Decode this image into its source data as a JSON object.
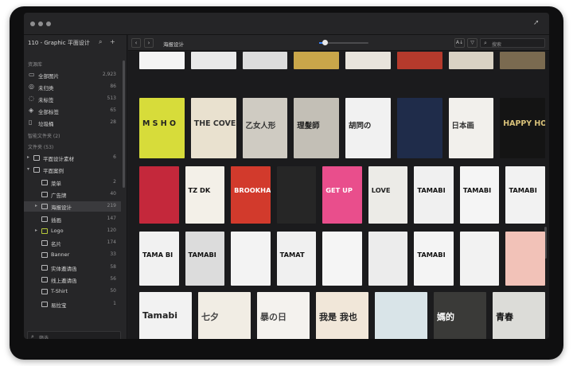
{
  "window": {
    "traffic_lights": 3
  },
  "sidebar": {
    "library_title": "110 - Graphic 平面设计",
    "sections": {
      "resources": "资源库",
      "smart": "智能文件夹 (2)",
      "folders": "文件夹 (53)"
    },
    "library_items": [
      {
        "label": "全部图片",
        "count": "2,923",
        "icon": "images-icon"
      },
      {
        "label": "未归类",
        "count": "86",
        "icon": "uncategorized-icon"
      },
      {
        "label": "未标签",
        "count": "513",
        "icon": "untagged-icon"
      },
      {
        "label": "全部标签",
        "count": "65",
        "icon": "tags-icon"
      },
      {
        "label": "垃圾桶",
        "count": "28",
        "icon": "trash-icon"
      }
    ],
    "folders": [
      {
        "label": "平面设计素材",
        "count": "6",
        "indent": 0,
        "arrow": "▸"
      },
      {
        "label": "平面案例",
        "count": "",
        "indent": 0,
        "arrow": "▾"
      },
      {
        "label": "菜单",
        "count": "2",
        "indent": 1,
        "arrow": ""
      },
      {
        "label": "广告牌",
        "count": "40",
        "indent": 1,
        "arrow": ""
      },
      {
        "label": "海报设计",
        "count": "219",
        "indent": 1,
        "arrow": "▸",
        "selected": true
      },
      {
        "label": "插画",
        "count": "147",
        "indent": 1,
        "arrow": ""
      },
      {
        "label": "Logo",
        "count": "120",
        "indent": 1,
        "arrow": "▸",
        "green": true
      },
      {
        "label": "名片",
        "count": "174",
        "indent": 1,
        "arrow": ""
      },
      {
        "label": "Banner",
        "count": "33",
        "indent": 1,
        "arrow": ""
      },
      {
        "label": "实体邀请函",
        "count": "58",
        "indent": 1,
        "arrow": ""
      },
      {
        "label": "线上邀请函",
        "count": "56",
        "indent": 1,
        "arrow": ""
      },
      {
        "label": "T-Shirt",
        "count": "50",
        "indent": 1,
        "arrow": ""
      },
      {
        "label": "易拉宝",
        "count": "1",
        "indent": 1,
        "arrow": ""
      }
    ],
    "filter_placeholder": "筛选"
  },
  "toolbar": {
    "back": "‹",
    "forward": "›",
    "breadcrumb": "海报设计",
    "zoom_fraction": 0.12,
    "sort_label": "A↓",
    "filter_icon": "filter-icon",
    "search_placeholder": "搜索"
  },
  "grid": {
    "rows": [
      [
        {
          "bg": "#f4f4f4"
        },
        {
          "bg": "#e9e9e9"
        },
        {
          "bg": "#dcdcdc"
        },
        {
          "bg": "#c9a64a"
        },
        {
          "bg": "#e8e4dc"
        },
        {
          "bg": "#b53a2c"
        },
        {
          "bg": "#d9d2c4"
        },
        {
          "bg": "#7a6a50"
        }
      ],
      [
        {
          "bg": "#d7dc3a",
          "text": "M S H O",
          "fg": "#222"
        },
        {
          "bg": "#e9e1cf",
          "text": "THE COVE",
          "fg": "#333"
        },
        {
          "bg": "#cfcbc2",
          "text": "乙女人形",
          "fg": "#333"
        },
        {
          "bg": "#c3bfb6",
          "text": "理髮師",
          "fg": "#222"
        },
        {
          "bg": "#f1f1f1",
          "text": "胡同の",
          "fg": "#222"
        },
        {
          "bg": "#1f2c4a"
        },
        {
          "bg": "#f2f0ec",
          "text": "日本画",
          "fg": "#333"
        },
        {
          "bg": "#141414",
          "text": "HAPPY HOUR",
          "fg": "#d9c27a"
        }
      ],
      [
        {
          "bg": "#c4283b"
        },
        {
          "bg": "#f3f0e8",
          "text": "TZ DK",
          "fg": "#111"
        },
        {
          "bg": "#d23a2c",
          "text": "BROOKHAVEN",
          "fg": "#fff"
        },
        {
          "bg": "#262626"
        },
        {
          "bg": "#e94e8c",
          "text": "GET UP",
          "fg": "#fff"
        },
        {
          "bg": "#ecebe7",
          "text": "LOVE",
          "fg": "#222"
        },
        {
          "bg": "#f0f0f0",
          "text": "TAMABI",
          "fg": "#111"
        },
        {
          "bg": "#f5f5f5",
          "text": "TAMABI",
          "fg": "#111"
        },
        {
          "bg": "#f2f2f2",
          "text": "TAMABI",
          "fg": "#111"
        }
      ],
      [
        {
          "bg": "#f1f1f1",
          "text": "TAMA BI",
          "fg": "#111"
        },
        {
          "bg": "#dcdcdc",
          "text": "TAMABI",
          "fg": "#111"
        },
        {
          "bg": "#f3f3f3"
        },
        {
          "bg": "#f0f0f0",
          "text": "TAMAT",
          "fg": "#111"
        },
        {
          "bg": "#f5f5f5"
        },
        {
          "bg": "#ececec"
        },
        {
          "bg": "#f4f4f4",
          "text": "TAMABI",
          "fg": "#111"
        },
        {
          "bg": "#f2f2f2"
        },
        {
          "bg": "#f2c2b8"
        }
      ],
      [
        {
          "bg": "#f2f2f2",
          "text": "Tamabi",
          "fg": "#222"
        },
        {
          "bg": "#f1ede4",
          "text": "七夕",
          "fg": "#444"
        },
        {
          "bg": "#f4f2ee",
          "text": "暴の日",
          "fg": "#444"
        },
        {
          "bg": "#f1e7d9",
          "text": "我是 我也",
          "fg": "#222"
        },
        {
          "bg": "#d9e4e8"
        },
        {
          "bg": "#3a3a38",
          "text": "媽的",
          "fg": "#fff"
        },
        {
          "bg": "#dcdcd8",
          "text": "青春",
          "fg": "#111"
        }
      ]
    ]
  }
}
